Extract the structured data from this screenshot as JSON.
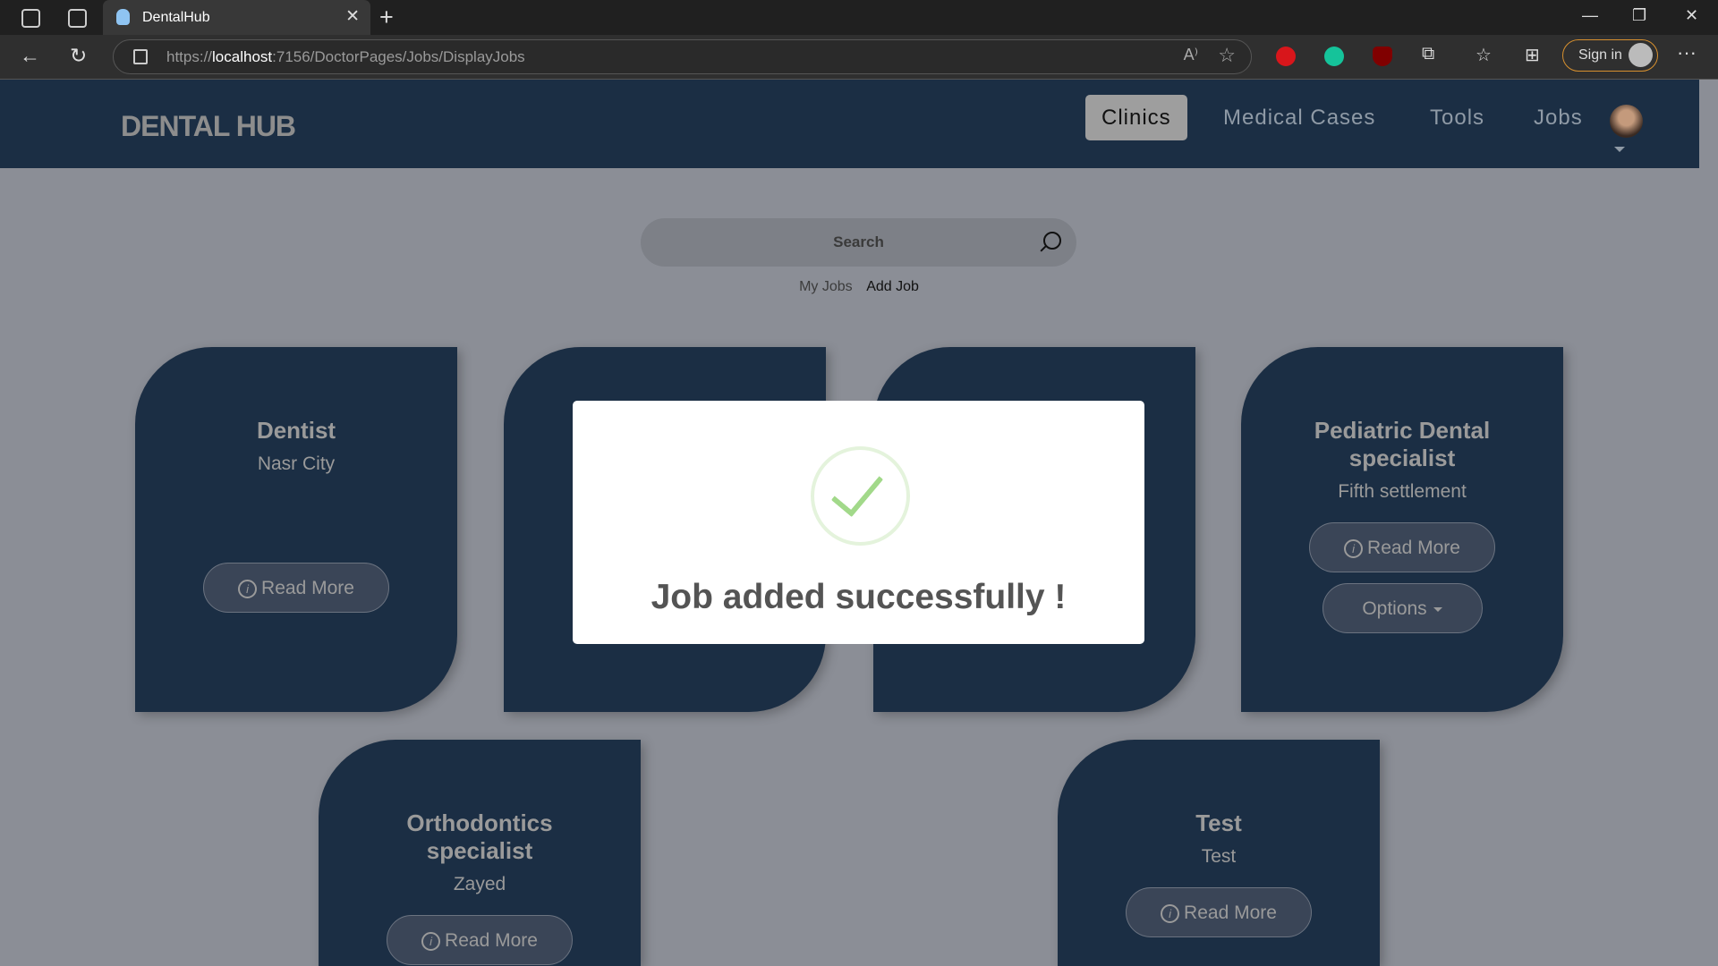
{
  "browser": {
    "tab_title": "DentalHub",
    "url_prefix": "https://",
    "url_host": "localhost",
    "url_rest": ":7156/DoctorPages/Jobs/DisplayJobs",
    "sign_in": "Sign in",
    "extensions": [
      "adblock-icon",
      "grammarly-icon",
      "ublock-icon",
      "puzzle-icon"
    ]
  },
  "header": {
    "logo": "DENTAL HUB",
    "nav": [
      {
        "label": "Clinics",
        "active": true
      },
      {
        "label": "Medical Cases"
      },
      {
        "label": "Tools"
      },
      {
        "label": "Jobs"
      }
    ]
  },
  "search": {
    "placeholder": "Search"
  },
  "links": {
    "my_jobs": "My Jobs",
    "add_job": "Add Job"
  },
  "cards": [
    {
      "title": "Dentist",
      "location": "Nasr City",
      "read_more": "Read More"
    },
    {
      "title": "Pediatric Dental specialist",
      "location": "Fifth settlement",
      "read_more": "Read More",
      "options": "Options"
    },
    {
      "title": "Orthodontics specialist",
      "location": "Zayed",
      "read_more": "Read More"
    },
    {
      "title": "Test",
      "location": "Test",
      "read_more": "Read More"
    }
  ],
  "modal": {
    "message": "Job added successfully !",
    "icon": "success-check-icon",
    "accent": "#a2d98a"
  }
}
